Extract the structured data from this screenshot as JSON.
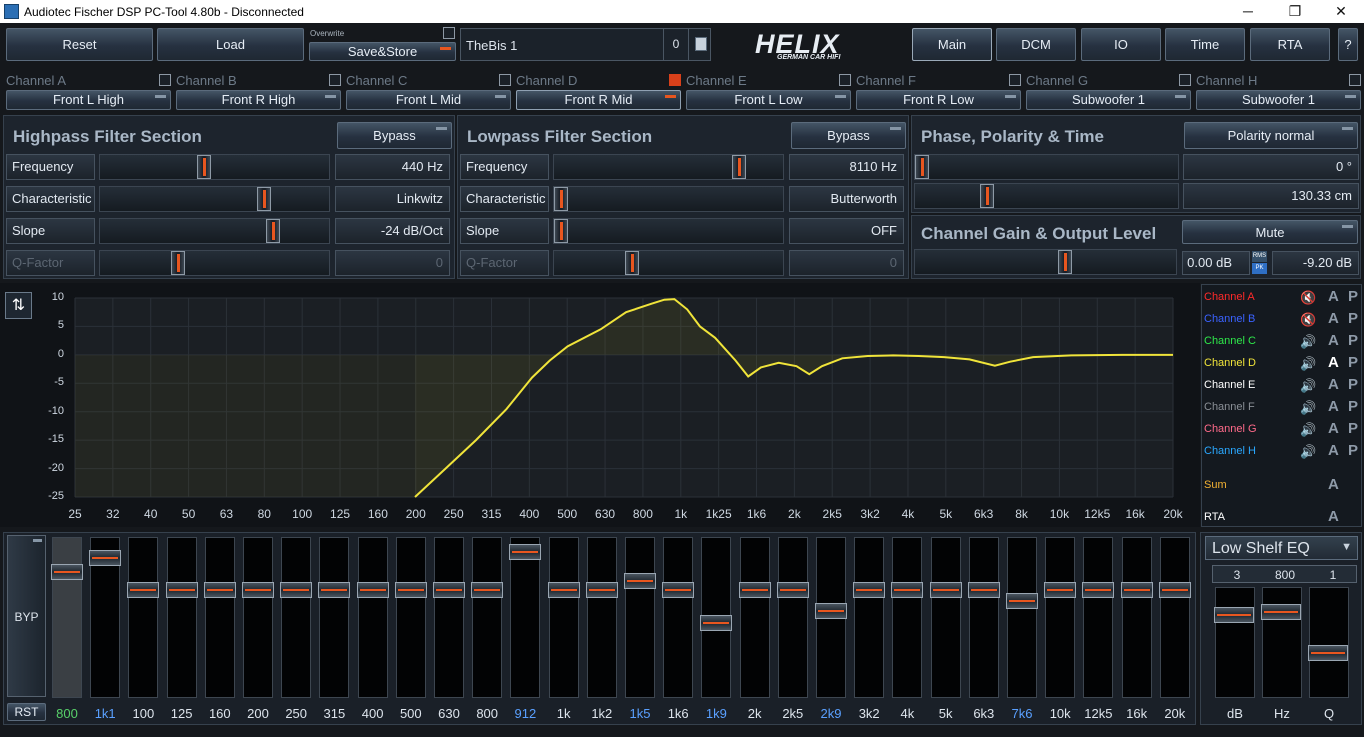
{
  "window": {
    "title": "Audiotec Fischer DSP PC-Tool 4.80b - Disconnected",
    "min_glyph": "─",
    "max_glyph": "❐",
    "close_glyph": "✕"
  },
  "toolbar": {
    "reset": "Reset",
    "load": "Load",
    "overwrite": "Overwrite",
    "save_store": "Save&Store",
    "preset_name": "TheBis 1",
    "preset_number": "0",
    "logo": "HELIX",
    "logo_sub": "GERMAN CAR HIFI",
    "nav": [
      "Main",
      "DCM",
      "IO",
      "Time",
      "RTA",
      "?"
    ]
  },
  "channels": [
    {
      "name": "Channel A",
      "assign": "Front L High",
      "checked": false
    },
    {
      "name": "Channel B",
      "assign": "Front R High",
      "checked": false
    },
    {
      "name": "Channel C",
      "assign": "Front L Mid",
      "checked": false
    },
    {
      "name": "Channel D",
      "assign": "Front R Mid",
      "checked": true
    },
    {
      "name": "Channel E",
      "assign": "Front L Low",
      "checked": false
    },
    {
      "name": "Channel F",
      "assign": "Front R Low",
      "checked": false
    },
    {
      "name": "Channel G",
      "assign": "Subwoofer 1",
      "checked": false
    },
    {
      "name": "Channel H",
      "assign": "Subwoofer 1",
      "checked": false
    }
  ],
  "highpass": {
    "title": "Highpass Filter Section",
    "bypass": "Bypass",
    "rows": [
      {
        "label": "Frequency",
        "value": "440 Hz",
        "level": 0.45
      },
      {
        "label": "Characteristic",
        "value": "Linkwitz",
        "level": 0.73
      },
      {
        "label": "Slope",
        "value": "-24 dB/Oct",
        "level": 0.77
      },
      {
        "label": "Q-Factor",
        "value": "0",
        "level": 0.33
      }
    ]
  },
  "lowpass": {
    "title": "Lowpass Filter Section",
    "bypass": "Bypass",
    "rows": [
      {
        "label": "Frequency",
        "value": "8110 Hz",
        "level": 0.83
      },
      {
        "label": "Characteristic",
        "value": "Butterworth",
        "level": 0.0
      },
      {
        "label": "Slope",
        "value": "OFF",
        "level": 0.0
      },
      {
        "label": "Q-Factor",
        "value": "0",
        "level": 0.33
      }
    ]
  },
  "phase": {
    "title": "Phase, Polarity & Time",
    "polarity": "Polarity normal",
    "phase_value": "0 °",
    "phase_level": 0.0,
    "time_value": "130.33 cm",
    "time_level": 0.26
  },
  "gain": {
    "title": "Channel Gain & Output Level",
    "mute": "Mute",
    "gain_value": "0.00 dB",
    "rms": "RMS",
    "pk": "PK",
    "output_value": "-9.20 dB",
    "gain_level": 0.58
  },
  "graph": {
    "yticks": [
      "10",
      "5",
      "0",
      "-5",
      "-10",
      "-15",
      "-20",
      "-25"
    ],
    "xticks": [
      "25",
      "32",
      "40",
      "50",
      "63",
      "80",
      "100",
      "125",
      "160",
      "200",
      "250",
      "315",
      "400",
      "500",
      "630",
      "800",
      "1k",
      "1k25",
      "1k6",
      "2k",
      "2k5",
      "3k2",
      "4k",
      "5k",
      "6k3",
      "8k",
      "10k",
      "12k5",
      "16k",
      "20k"
    ],
    "curve_color": "#f0e43a"
  },
  "legend": [
    {
      "name": "Channel A",
      "color": "#ff2a2a",
      "spk": "🔇",
      "a": "A",
      "p": "P"
    },
    {
      "name": "Channel B",
      "color": "#3a62ff",
      "spk": "🔇",
      "a": "A",
      "p": "P"
    },
    {
      "name": "Channel C",
      "color": "#2ee84a",
      "spk": "🔊",
      "a": "A",
      "p": "P"
    },
    {
      "name": "Channel D",
      "color": "#f0e43a",
      "spk": "🔊",
      "a": "A",
      "p": "P",
      "active": true
    },
    {
      "name": "Channel E",
      "color": "#ffffff",
      "spk": "🔊",
      "a": "A",
      "p": "P"
    },
    {
      "name": "Channel F",
      "color": "#8a8f96",
      "spk": "🔊",
      "a": "A",
      "p": "P"
    },
    {
      "name": "Channel G",
      "color": "#ff6a8a",
      "spk": "🔊",
      "a": "A",
      "p": "P"
    },
    {
      "name": "Channel H",
      "color": "#2aa8ff",
      "spk": "🔊",
      "a": "A",
      "p": "P"
    },
    {
      "name": "Sum",
      "color": "#f2b133",
      "a": "A"
    },
    {
      "name": "RTA",
      "color": "#ffffff",
      "a": "A"
    }
  ],
  "eq": {
    "byp": "BYP",
    "rst": "RST",
    "bands": [
      {
        "label": "800",
        "level": 0.82,
        "color": "green"
      },
      {
        "label": "1k1",
        "level": 0.92,
        "color": "blue"
      },
      {
        "label": "100",
        "level": 0.7
      },
      {
        "label": "125",
        "level": 0.7
      },
      {
        "label": "160",
        "level": 0.7
      },
      {
        "label": "200",
        "level": 0.7
      },
      {
        "label": "250",
        "level": 0.7
      },
      {
        "label": "315",
        "level": 0.7
      },
      {
        "label": "400",
        "level": 0.7
      },
      {
        "label": "500",
        "level": 0.7
      },
      {
        "label": "630",
        "level": 0.7
      },
      {
        "label": "800",
        "level": 0.7
      },
      {
        "label": "912",
        "level": 0.96,
        "color": "blue"
      },
      {
        "label": "1k",
        "level": 0.7
      },
      {
        "label": "1k2",
        "level": 0.7
      },
      {
        "label": "1k5",
        "level": 0.76,
        "color": "blue"
      },
      {
        "label": "1k6",
        "level": 0.7
      },
      {
        "label": "1k9",
        "level": 0.47,
        "color": "blue"
      },
      {
        "label": "2k",
        "level": 0.7
      },
      {
        "label": "2k5",
        "level": 0.7
      },
      {
        "label": "2k9",
        "level": 0.55,
        "color": "blue"
      },
      {
        "label": "3k2",
        "level": 0.7
      },
      {
        "label": "4k",
        "level": 0.7
      },
      {
        "label": "5k",
        "level": 0.7
      },
      {
        "label": "6k3",
        "level": 0.7
      },
      {
        "label": "7k6",
        "level": 0.62,
        "color": "blue"
      },
      {
        "label": "10k",
        "level": 0.7
      },
      {
        "label": "12k5",
        "level": 0.7
      },
      {
        "label": "16k",
        "level": 0.7
      },
      {
        "label": "20k",
        "level": 0.7
      }
    ]
  },
  "shelf": {
    "type": "Low Shelf EQ",
    "db": "3",
    "hz": "800",
    "q": "1",
    "db_label": "dB",
    "hz_label": "Hz",
    "q_label": "Q",
    "db_level": 0.8,
    "hz_level": 0.83,
    "q_level": 0.4
  }
}
